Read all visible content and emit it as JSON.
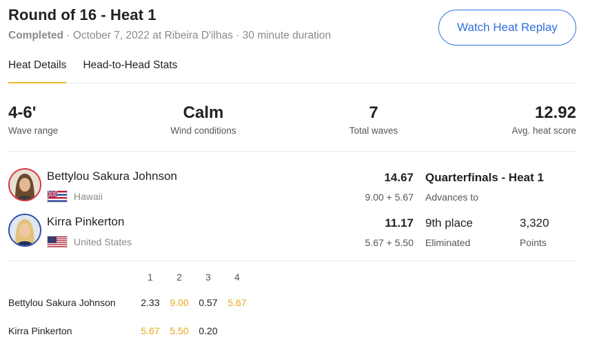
{
  "header": {
    "title": "Round of 16 - Heat 1",
    "status": "Completed",
    "details": " · October 7, 2022 at Ribeira D'ilhas · 30 minute duration",
    "replay_button": "Watch Heat Replay"
  },
  "tabs": [
    {
      "label": "Heat Details",
      "active": true
    },
    {
      "label": "Head-to-Head Stats",
      "active": false
    }
  ],
  "stats": [
    {
      "value": "4-6'",
      "label": "Wave range"
    },
    {
      "value": "Calm",
      "label": "Wind conditions"
    },
    {
      "value": "7",
      "label": "Total waves"
    },
    {
      "value": "12.92",
      "label": "Avg. heat score"
    }
  ],
  "surfers": [
    {
      "name": "Bettylou Sakura Johnson",
      "country": "Hawaii",
      "flag": "hawaii-flag",
      "score": "14.67",
      "breakdown": "9.00 + 5.67",
      "result": "Quarterfinals - Heat 1",
      "result_sub": "Advances to"
    },
    {
      "name": "Kirra Pinkerton",
      "country": "United States",
      "flag": "usa-flag",
      "score": "11.17",
      "breakdown": "5.67 + 5.50",
      "result": "9th place",
      "result_sub": "Eliminated",
      "points": "3,320",
      "points_label": "Points"
    }
  ],
  "wave_table": {
    "columns": [
      "1",
      "2",
      "3",
      "4"
    ],
    "rows": [
      {
        "name": "Bettylou Sakura Johnson",
        "waves": [
          "2.33",
          "9.00",
          "0.57",
          "5.67"
        ],
        "highlight": [
          false,
          true,
          false,
          true
        ]
      },
      {
        "name": "Kirra Pinkerton",
        "waves": [
          "5.67",
          "5.50",
          "0.20",
          ""
        ],
        "highlight": [
          true,
          true,
          false,
          false
        ]
      }
    ]
  },
  "colors": {
    "accent_blue": "#2f6fde",
    "highlight_gold": "#e6a817",
    "tab_underline": "#f0b429"
  }
}
